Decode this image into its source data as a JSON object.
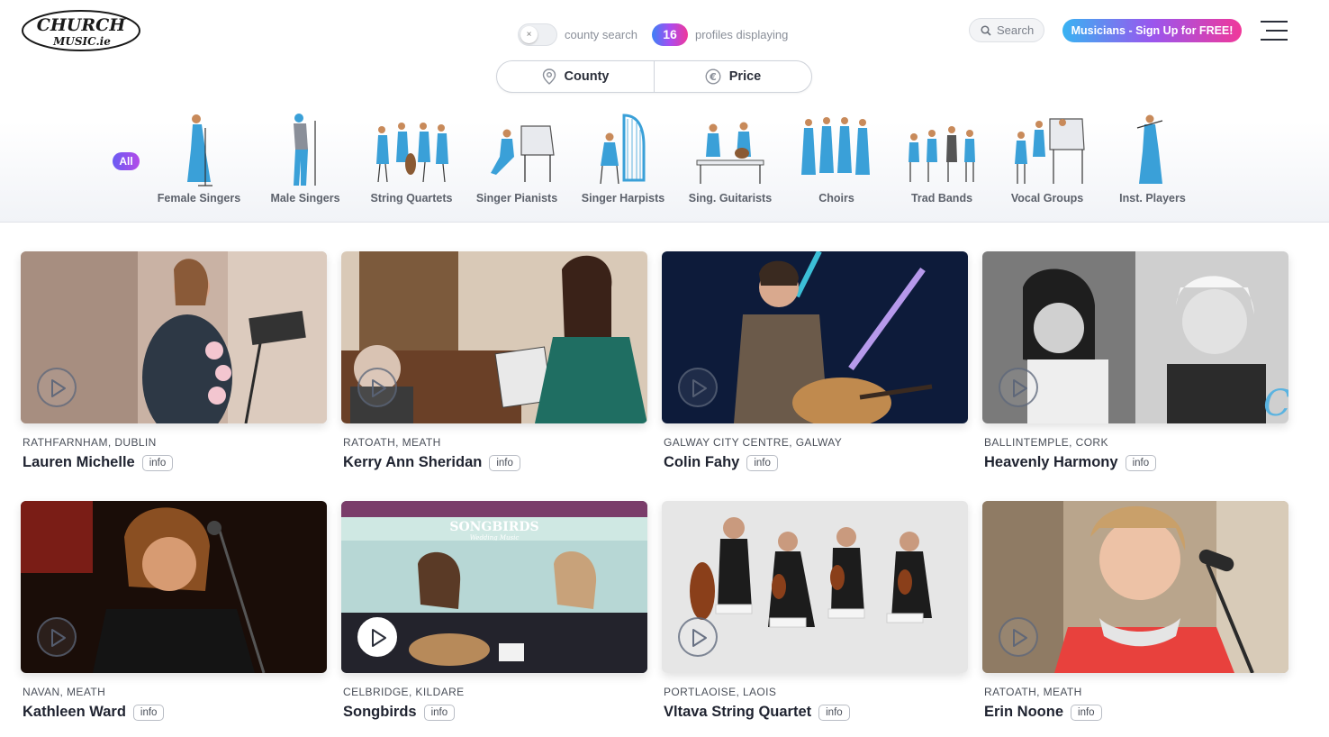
{
  "header": {
    "logo_text_1": "CHURCH",
    "logo_text_2": "MUSIC.ie",
    "county_search_label": "county search",
    "profile_count": "16",
    "profiles_label": "profiles displaying",
    "search_label": "Search",
    "signup_label": "Musicians - Sign Up for FREE!"
  },
  "filters": {
    "county_label": "County",
    "price_label": "Price"
  },
  "categories": {
    "all_label": "All",
    "items": [
      {
        "label": "Female Singers",
        "icon": "female-singer-icon"
      },
      {
        "label": "Male Singers",
        "icon": "male-singer-icon"
      },
      {
        "label": "String Quartets",
        "icon": "string-quartet-icon"
      },
      {
        "label": "Singer Pianists",
        "icon": "singer-pianist-icon"
      },
      {
        "label": "Singer Harpists",
        "icon": "singer-harpist-icon"
      },
      {
        "label": "Sing. Guitarists",
        "icon": "singer-guitarist-icon"
      },
      {
        "label": "Choirs",
        "icon": "choir-icon"
      },
      {
        "label": "Trad Bands",
        "icon": "trad-band-icon"
      },
      {
        "label": "Vocal Groups",
        "icon": "vocal-group-icon"
      },
      {
        "label": "Inst. Players",
        "icon": "instrument-player-icon"
      }
    ]
  },
  "profiles": [
    {
      "location": "RATHFARNHAM, DUBLIN",
      "name": "Lauren Michelle",
      "info": "info"
    },
    {
      "location": "RATOATH, MEATH",
      "name": "Kerry Ann Sheridan",
      "info": "info"
    },
    {
      "location": "GALWAY CITY CENTRE, GALWAY",
      "name": "Colin Fahy",
      "info": "info"
    },
    {
      "location": "BALLINTEMPLE, CORK",
      "name": "Heavenly Harmony",
      "info": "info"
    },
    {
      "location": "NAVAN, MEATH",
      "name": "Kathleen Ward",
      "info": "info"
    },
    {
      "location": "CELBRIDGE, KILDARE",
      "name": "Songbirds",
      "info": "info",
      "overlay_text_1": "SONGBIRDS",
      "overlay_text_2": "Wedding Music"
    },
    {
      "location": "PORTLAOISE, LAOIS",
      "name": "Vltava String Quartet",
      "info": "info"
    },
    {
      "location": "RATOATH, MEATH",
      "name": "Erin Noone",
      "info": "info"
    }
  ],
  "colors": {
    "accent_blue": "#38b3f2",
    "accent_pink": "#f0389a",
    "accent_purple": "#9a56ee",
    "text_dark": "#1f2330"
  }
}
